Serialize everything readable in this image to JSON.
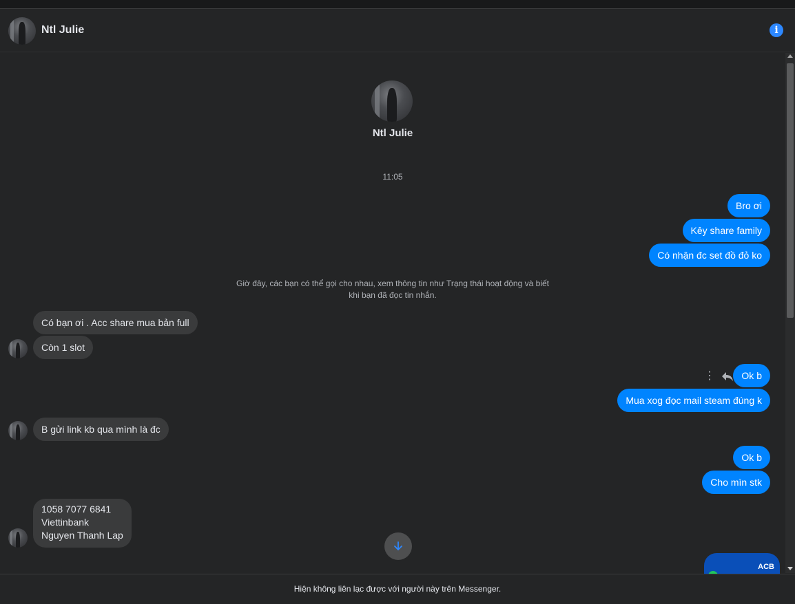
{
  "conversation": {
    "contact_name": "Ntl Julie",
    "profile_name": "Ntl Julie",
    "timestamp": "11:05",
    "system_message": "Giờ đây, các bạn có thể gọi cho nhau, xem thông tin như Trạng thái hoạt động và biết khi bạn đã đọc tin nhắn.",
    "footer_notice": "Hiện không liên lạc được với người này trên Messenger."
  },
  "messages": {
    "out1": "Bro ơi",
    "out2": "Kêy share family",
    "out3": "Có nhận đc set đồ đỏ ko",
    "in1": "Có bạn ơi . Acc share mua bản full",
    "in2": "Còn 1 slot",
    "out4": "Ok b",
    "out5": "Mua xog đọc mail steam đúng k",
    "in3": "B gửi link kb qua mình là đc",
    "out6": "Ok b",
    "out7": "Cho mìn stk",
    "in4_line1": "1058 7077 6841",
    "in4_line2": "Viettinbank",
    "in4_line3": "Nguyen Thanh Lap",
    "image_label": "ACB"
  },
  "icons": {
    "info": "info-icon",
    "more": "more-options-icon",
    "reply": "reply-icon",
    "scroll_down": "arrow-down-icon"
  },
  "colors": {
    "outgoing_bubble": "#0084ff",
    "incoming_bubble": "#3a3b3c",
    "background": "#242526",
    "accent": "#2d88ff"
  }
}
